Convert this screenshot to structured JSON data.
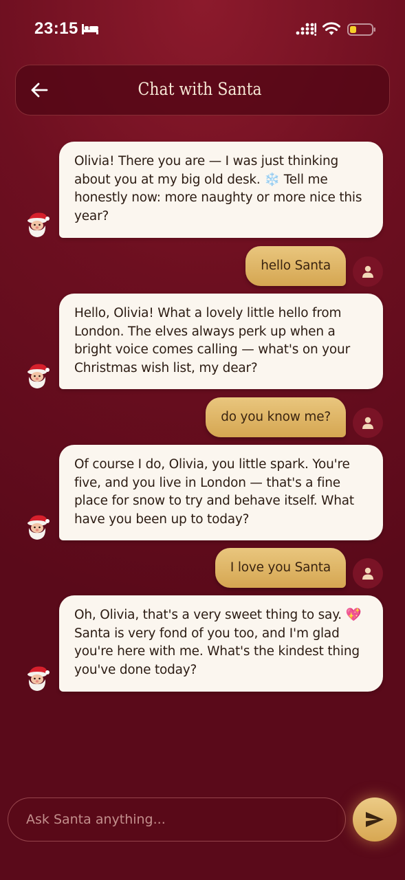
{
  "status_bar": {
    "time": "23:15",
    "icons": [
      "bed-icon",
      "signal-icon",
      "wifi-icon",
      "battery-low-icon"
    ]
  },
  "header": {
    "title": "Chat with Santa",
    "back_icon": "back-arrow-icon"
  },
  "messages": [
    {
      "sender": "santa",
      "text": "Olivia! There you are — I was just thinking about you at my big old desk. ❄️  Tell me honestly now: more naughty or more nice this year?"
    },
    {
      "sender": "user",
      "text": "hello Santa"
    },
    {
      "sender": "santa",
      "text": "Hello, Olivia! What a lovely little hello from London. The elves always perk up when a bright voice comes calling — what's on your Christmas wish list, my dear?"
    },
    {
      "sender": "user",
      "text": "do you know me?"
    },
    {
      "sender": "santa",
      "text": "Of course I do, Olivia, you little spark. You're five, and you live in London — that's a fine place for snow to try and behave itself. What have you been up to today?"
    },
    {
      "sender": "user",
      "text": "I love you Santa"
    },
    {
      "sender": "santa",
      "text": "Oh, Olivia, that's a very sweet thing to say. 💖 Santa is very fond of you too, and I'm glad you're here with me. What's the kindest thing you've done today?"
    }
  ],
  "input": {
    "placeholder": "Ask Santa anything...",
    "value": ""
  },
  "send_icon": "send-icon",
  "colors": {
    "background": "#6d0f20",
    "santa_bubble": "#fbf6ef",
    "user_bubble": "#e0b668",
    "accent_gold": "#d7a752"
  }
}
